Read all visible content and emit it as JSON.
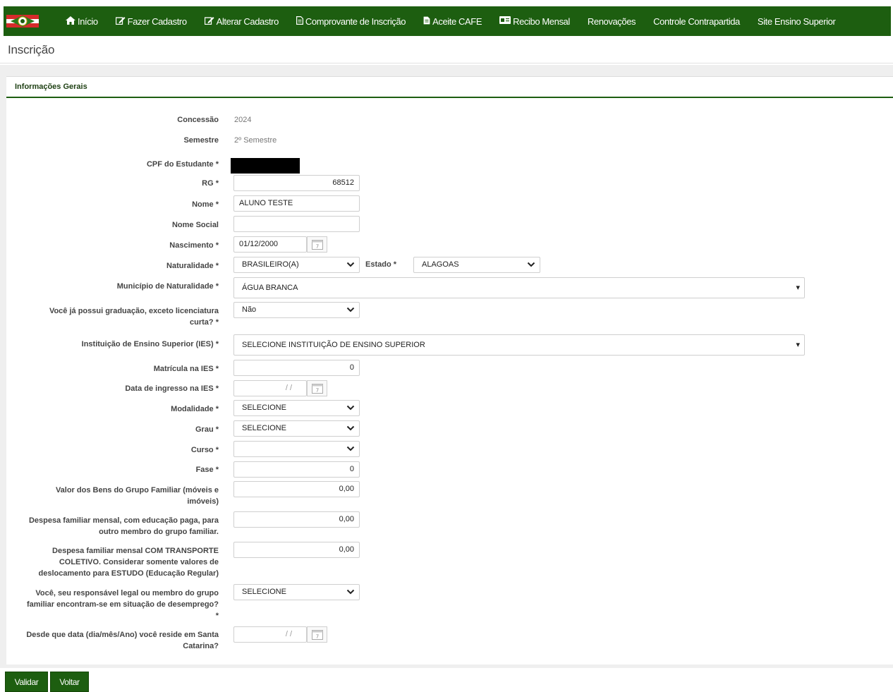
{
  "nav": {
    "items": [
      {
        "icon": "home-icon",
        "label": "Início"
      },
      {
        "icon": "edit-icon",
        "label": "Fazer Cadastro"
      },
      {
        "icon": "edit-icon",
        "label": "Alterar Cadastro"
      },
      {
        "icon": "file-icon",
        "label": "Comprovante de Inscrição"
      },
      {
        "icon": "file-icon",
        "label": "Aceite CAFE"
      },
      {
        "icon": "card-icon",
        "label": "Recibo Mensal"
      },
      {
        "label": "Renovações"
      },
      {
        "label": "Controle Contrapartida"
      },
      {
        "label": "Site Ensino Superior"
      }
    ]
  },
  "page": {
    "title": "Inscrição"
  },
  "panel": {
    "title": "Informações Gerais"
  },
  "form": {
    "concessao": {
      "label": "Concessão",
      "value": "2024"
    },
    "semestre": {
      "label": "Semestre",
      "value": "2º Semestre"
    },
    "cpf": {
      "label": "CPF do Estudante *"
    },
    "rg": {
      "label": "RG *",
      "value": "68512"
    },
    "nome": {
      "label": "Nome *",
      "value": "ALUNO TESTE"
    },
    "nome_social": {
      "label": "Nome Social",
      "value": ""
    },
    "nascimento": {
      "label": "Nascimento *",
      "value": "01/12/2000"
    },
    "naturalidade": {
      "label": "Naturalidade *",
      "value": "BRASILEIRO(A)"
    },
    "estado": {
      "label": "Estado *",
      "value": "ALAGOAS"
    },
    "municipio": {
      "label": "Município de Naturalidade *",
      "value": "ÁGUA BRANCA"
    },
    "graduacao": {
      "label_1": "Você já possui graduação, exceto licenciatura",
      "label_2": "curta? *",
      "value": "Não"
    },
    "ies": {
      "label": "Instituição de Ensino Superior (IES) *",
      "value": "SELECIONE INSTITUIÇÃO DE ENSINO SUPERIOR"
    },
    "matricula": {
      "label": "Matrícula na IES *",
      "value": "0"
    },
    "ingresso": {
      "label": "Data de ingresso na IES *",
      "value": "/ /"
    },
    "modalidade": {
      "label": "Modalidade *",
      "value": "SELECIONE"
    },
    "grau": {
      "label": "Grau *",
      "value": "SELECIONE"
    },
    "curso": {
      "label": "Curso *",
      "value": ""
    },
    "fase": {
      "label": "Fase *",
      "value": "0"
    },
    "bens": {
      "label_1": "Valor dos Bens do Grupo Familiar (móveis e",
      "label_2": "imóveis)",
      "value": "0,00"
    },
    "despesa_educacao": {
      "label_1": "Despesa familiar mensal, com educação paga, para",
      "label_2": "outro membro do grupo familiar.",
      "value": "0,00"
    },
    "despesa_transporte": {
      "label_1": "Despesa familiar mensal COM TRANSPORTE",
      "label_2": "COLETIVO. Considerar somente valores de",
      "label_3": "deslocamento para ESTUDO (Educação Regular)",
      "value": "0,00"
    },
    "desemprego": {
      "label_1": "Você, seu responsável legal ou membro do grupo",
      "label_2": "familiar encontram-se em situação de desemprego?",
      "label_3": "*",
      "value": "SELECIONE"
    },
    "reside": {
      "label_1": "Desde que data (dia/mês/Ano) você reside em Santa",
      "label_2": "Catarina?",
      "value": "/ /"
    }
  },
  "buttons": {
    "validar": "Validar",
    "voltar": "Voltar"
  },
  "colors": {
    "brand_green": "#1d5e10",
    "flag_red": "#d62b2b"
  }
}
